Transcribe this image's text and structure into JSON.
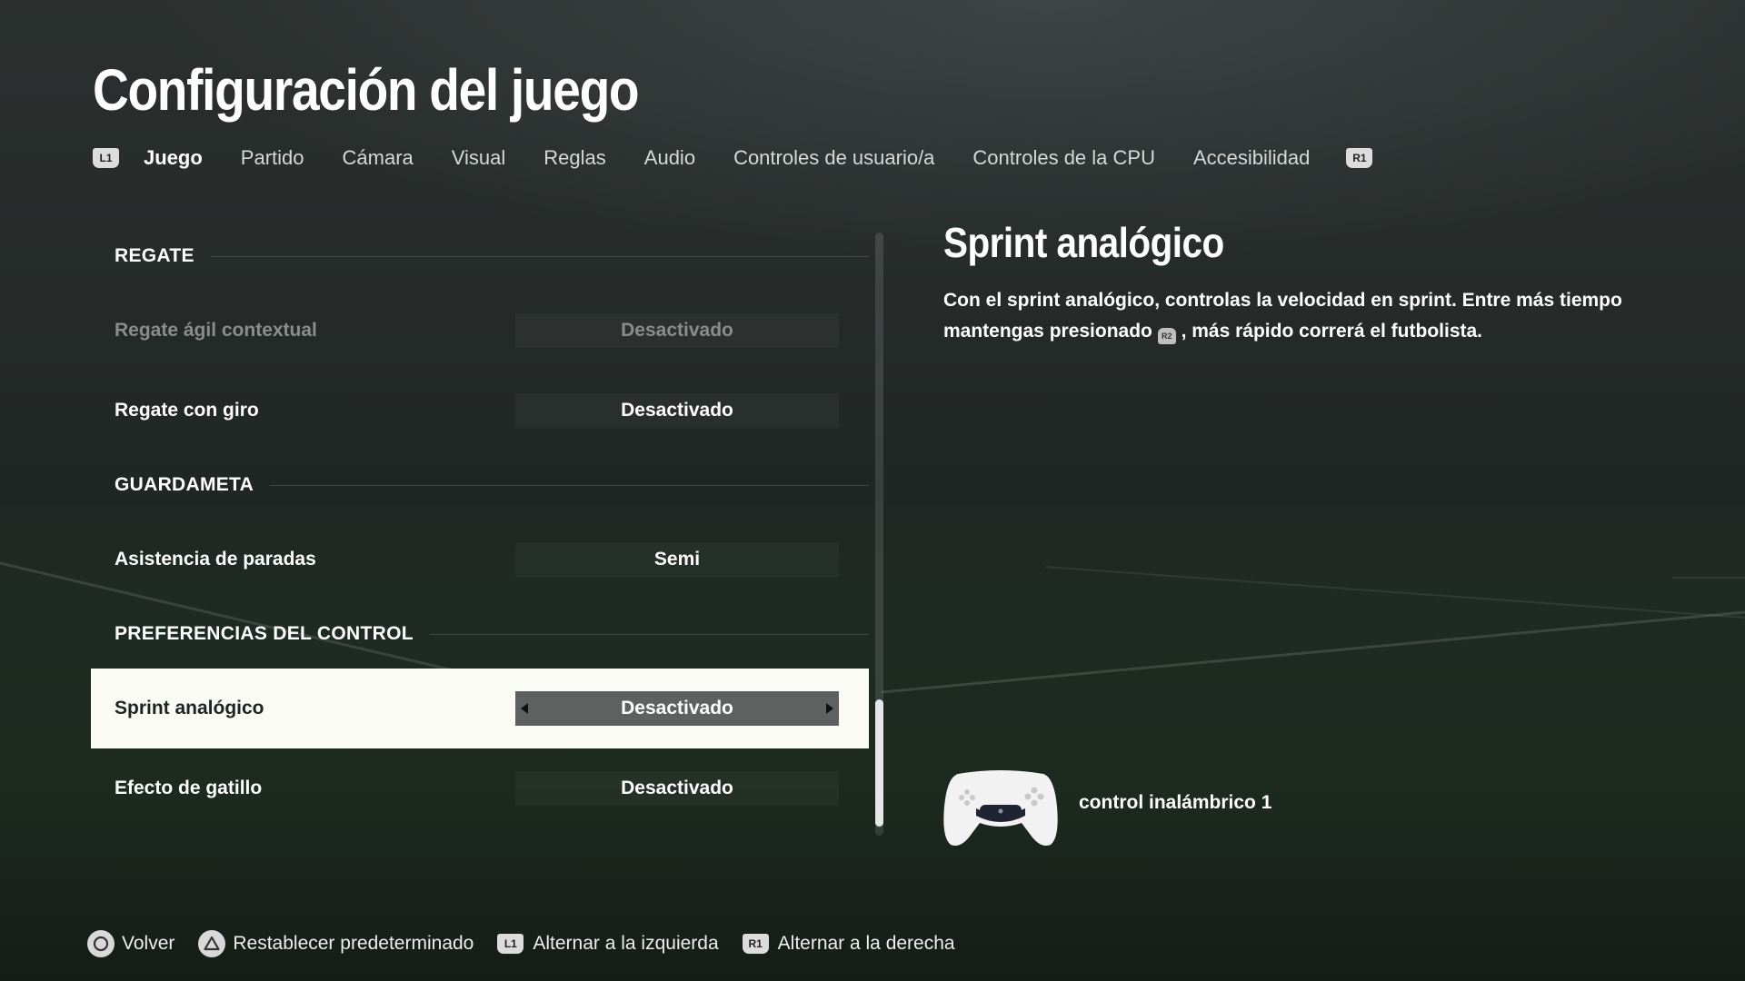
{
  "header": {
    "title": "Configuración del juego"
  },
  "tabs": {
    "left_button": "L1",
    "right_button": "R1",
    "items": [
      {
        "label": "Juego",
        "active": true
      },
      {
        "label": "Partido"
      },
      {
        "label": "Cámara"
      },
      {
        "label": "Visual"
      },
      {
        "label": "Reglas"
      },
      {
        "label": "Audio"
      },
      {
        "label": "Controles de usuario/a"
      },
      {
        "label": "Controles de la CPU"
      },
      {
        "label": "Accesibilidad"
      }
    ]
  },
  "settings": {
    "sections": [
      {
        "title": "REGATE"
      },
      {
        "title": "GUARDAMETA"
      },
      {
        "title": "PREFERENCIAS DEL CONTROL"
      }
    ],
    "rows": [
      {
        "label": "Regate ágil contextual",
        "value": "Desactivado",
        "disabled": true
      },
      {
        "label": "Regate con giro",
        "value": "Desactivado"
      },
      {
        "label": "Asistencia de paradas",
        "value": "Semi"
      },
      {
        "label": "Sprint analógico",
        "value": "Desactivado",
        "selected": true
      },
      {
        "label": "Efecto de gatillo",
        "value": "Desactivado"
      }
    ]
  },
  "description": {
    "title": "Sprint analógico",
    "text_before": "Con el sprint analógico, controlas la velocidad en sprint. Entre más tiempo mantengas presionado",
    "glyph": "R2",
    "text_after": ", más rápido correrá el futbolista."
  },
  "controller": {
    "label": "control inalámbrico 1",
    "icon": "dualsense-controller-icon"
  },
  "footer": {
    "items": [
      {
        "label": "Volver",
        "button": "circle-button-icon"
      },
      {
        "label": "Restablecer predeterminado",
        "button": "triangle-button-icon"
      },
      {
        "label": "Alternar a la izquierda",
        "button": "L1"
      },
      {
        "label": "Alternar a la derecha",
        "button": "R1"
      }
    ]
  },
  "colors": {
    "selected_row_bg": "#fbfbf6",
    "selected_value_bg": "#5d615f",
    "disabled_text": "#8a8d8b"
  }
}
